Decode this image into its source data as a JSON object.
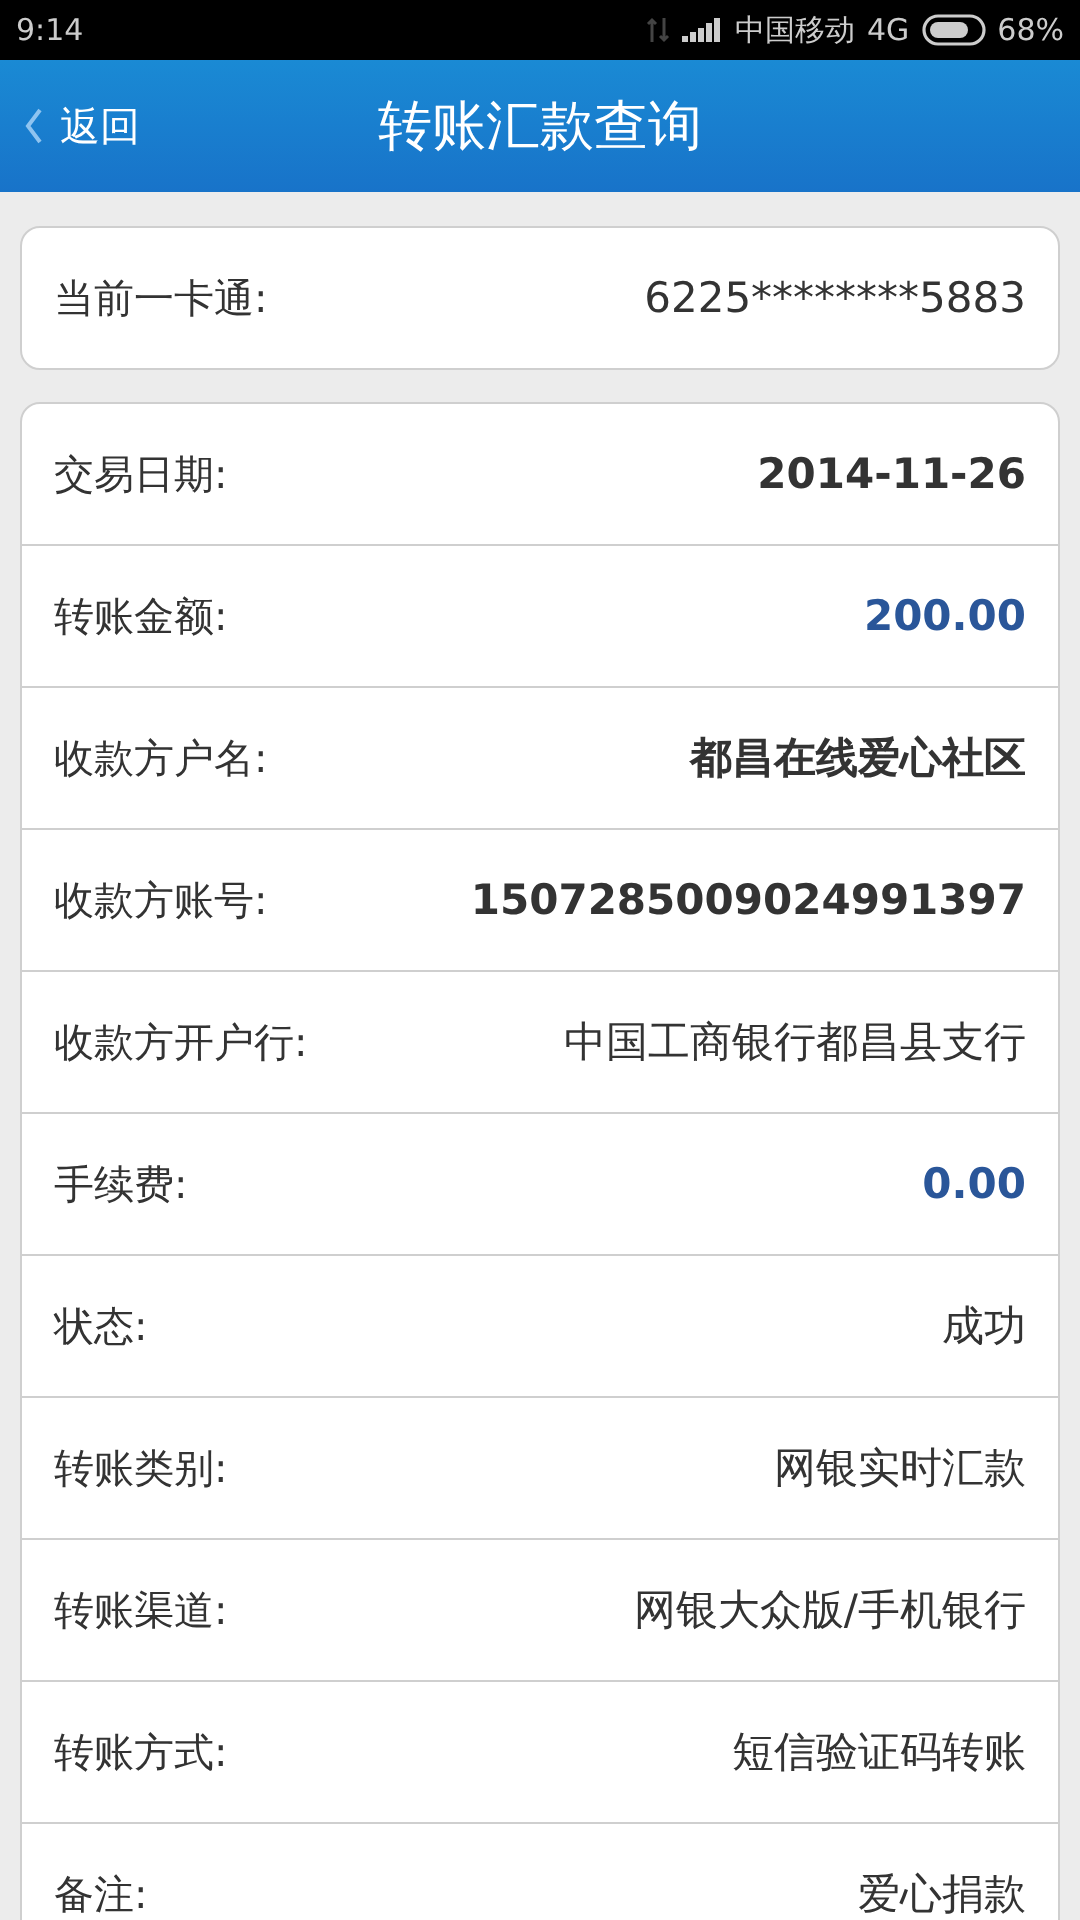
{
  "status_bar": {
    "time": "9:14",
    "carrier": "中国移动",
    "network": "4G",
    "battery": "68%"
  },
  "header": {
    "back": "返回",
    "title": "转账汇款查询"
  },
  "card": {
    "label": "当前一卡通:",
    "value": "6225********5883"
  },
  "details": [
    {
      "label": "交易日期:",
      "value": "2014-11-26",
      "kind": "bold"
    },
    {
      "label": "转账金额:",
      "value": "200.00",
      "kind": "amount"
    },
    {
      "label": "收款方户名:",
      "value": "都昌在线爱心社区",
      "kind": "bold"
    },
    {
      "label": "收款方账号:",
      "value": "1507285009024991397",
      "kind": "bold"
    },
    {
      "label": "收款方开户行:",
      "value": "中国工商银行都昌县支行",
      "kind": "plain"
    },
    {
      "label": "手续费:",
      "value": "0.00",
      "kind": "amount"
    },
    {
      "label": "状态:",
      "value": "成功",
      "kind": "plain"
    },
    {
      "label": "转账类别:",
      "value": "网银实时汇款",
      "kind": "plain"
    },
    {
      "label": "转账渠道:",
      "value": "网银大众版/手机银行",
      "kind": "plain"
    },
    {
      "label": "转账方式:",
      "value": "短信验证码转账",
      "kind": "plain"
    },
    {
      "label": "备注:",
      "value": "爱心捐款",
      "kind": "plain"
    }
  ]
}
